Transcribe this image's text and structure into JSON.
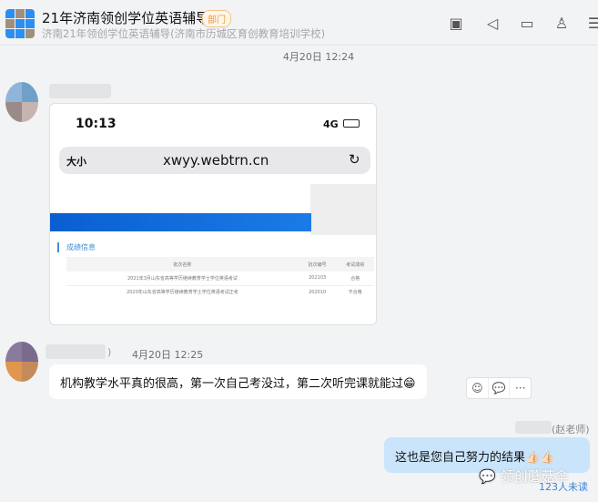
{
  "header": {
    "title": "21年济南领创学位英语辅导",
    "badge": "部门",
    "subtitle": "济南21年领创学位英语辅导(济南市历城区育创教育培训学校)",
    "icons": [
      "video-icon",
      "speaker-icon",
      "folder-icon",
      "add-user-icon",
      "menu-icon"
    ]
  },
  "messages": [
    {
      "time": "4月20日 12:24",
      "type": "image",
      "image": {
        "phone_time": "10:13",
        "network": "4G",
        "font_size_label": "大小",
        "url": "xwyy.webtrn.cn",
        "section": "成绩信息",
        "columns": [
          "批次名称",
          "批次编号",
          "考试成绩"
        ],
        "rows": [
          [
            "2021年3月山东省高等学历继续教育学士学位英语考试",
            "202103",
            "合格"
          ],
          [
            "2020年山东省高等学历继续教育学士学位英语考试正考",
            "202010",
            "不合格"
          ]
        ]
      }
    },
    {
      "name_suffix": ")",
      "time": "4月20日 12:25",
      "text": "机构教学水平真的很高，第一次自己考没过，第二次听完课就能过😁"
    },
    {
      "sender": "(赵老师)",
      "text": "这也是您自己努力的结果👍🏻👍🏻",
      "unread": "123人未读"
    }
  ],
  "watermark": "领创蘑菇伞",
  "actions": {
    "emoji": "☺",
    "reply": "💬",
    "more": "···"
  }
}
